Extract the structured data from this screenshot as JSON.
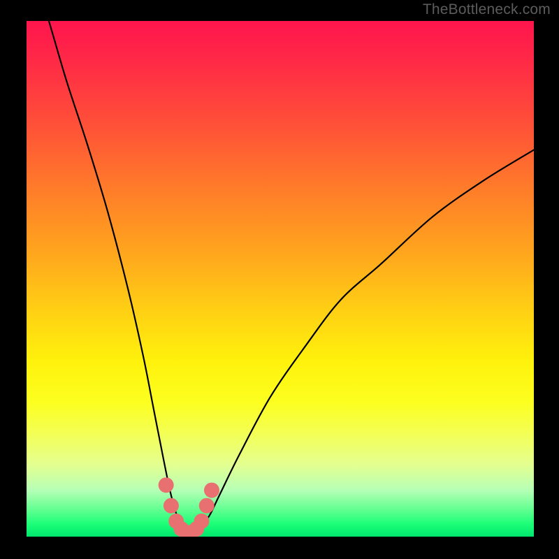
{
  "watermark": "TheBottleneck.com",
  "chart_data": {
    "type": "line",
    "title": "",
    "xlabel": "",
    "ylabel": "",
    "xlim": [
      0,
      100
    ],
    "ylim": [
      0,
      100
    ],
    "series": [
      {
        "name": "bottleneck-curve",
        "x": [
          0,
          2,
          5,
          8,
          12,
          16,
          20,
          23,
          25,
          27,
          28.5,
          30,
          31,
          32,
          33,
          34,
          36,
          38,
          42,
          48,
          55,
          62,
          70,
          80,
          90,
          100
        ],
        "values": [
          115,
          108,
          98,
          88,
          76,
          63,
          48,
          35,
          25,
          15,
          8,
          3,
          1,
          0,
          0.5,
          1.5,
          4,
          8,
          16,
          27,
          37,
          46,
          53,
          62,
          69,
          75
        ]
      },
      {
        "name": "marker-cluster",
        "x": [
          27.5,
          28.5,
          29.5,
          30.5,
          31.5,
          32.5,
          33.5,
          34.5,
          35.5,
          36.5
        ],
        "values": [
          10,
          6,
          3,
          1.5,
          0.8,
          0.8,
          1.5,
          3,
          6,
          9
        ]
      }
    ],
    "gradient_stops": [
      {
        "pos": 0.0,
        "color": "#ff154d"
      },
      {
        "pos": 0.66,
        "color": "#fff20c"
      },
      {
        "pos": 1.0,
        "color": "#00e66d"
      }
    ]
  }
}
